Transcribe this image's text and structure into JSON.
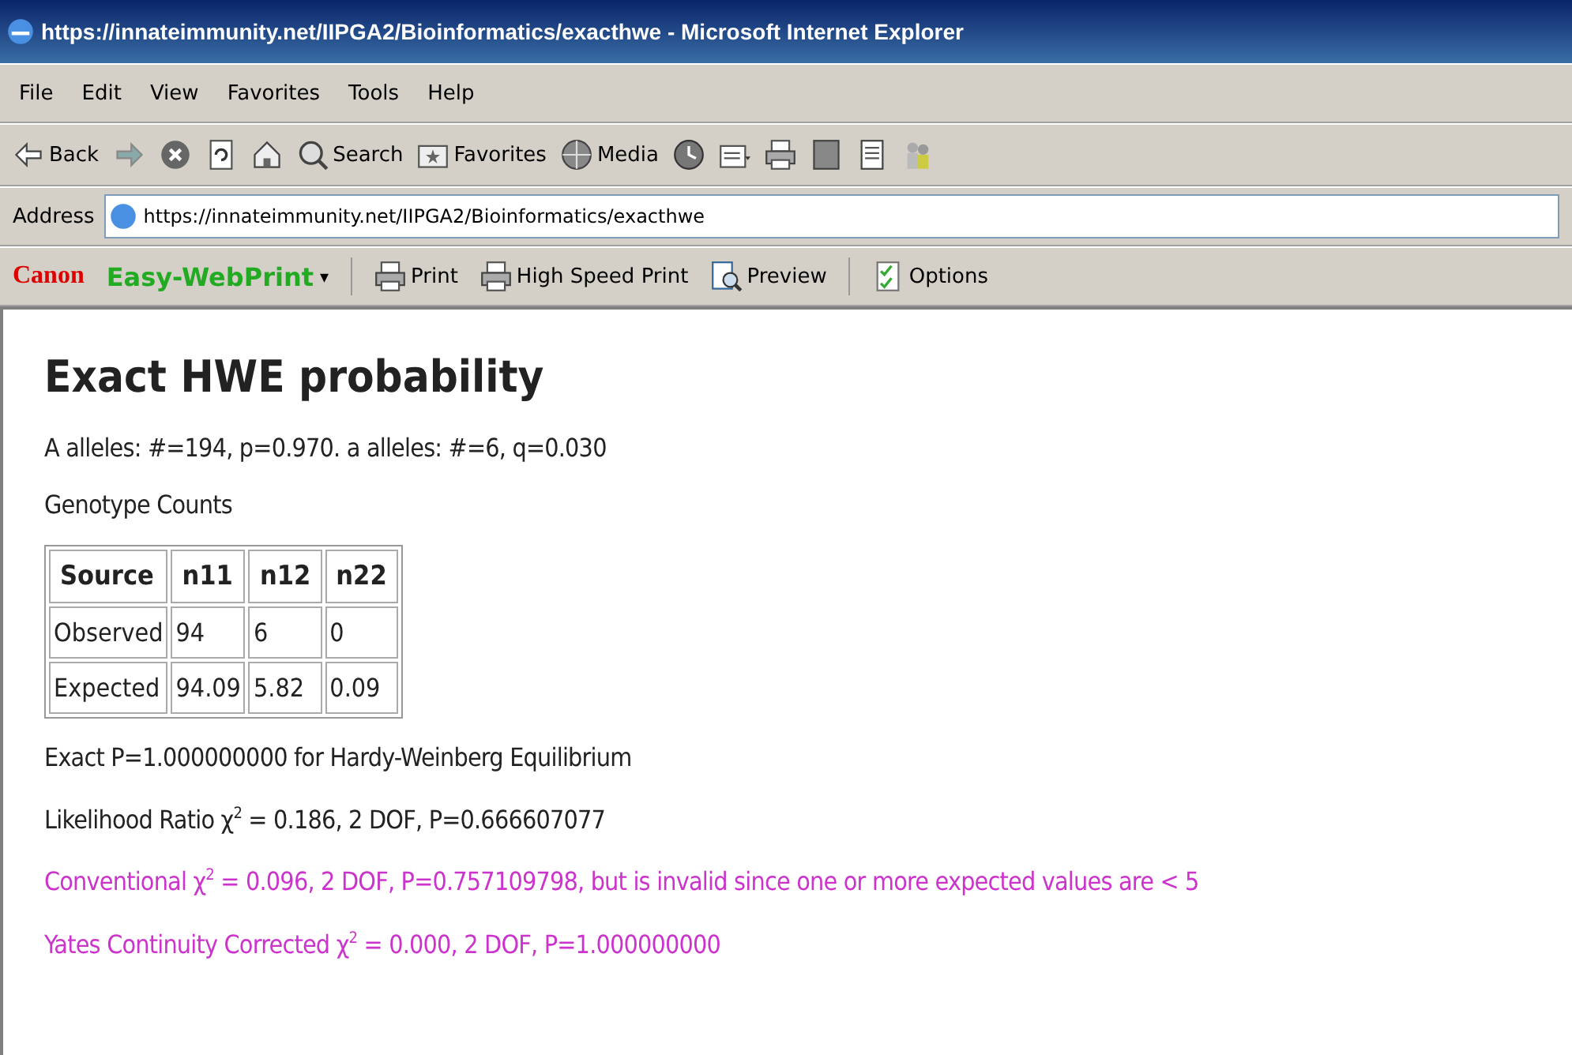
{
  "window": {
    "title": "https://innateimmunity.net/IIPGA2/Bioinformatics/exacthwe - Microsoft Internet Explorer"
  },
  "menu": [
    "File",
    "Edit",
    "View",
    "Favorites",
    "Tools",
    "Help"
  ],
  "toolbar": [
    {
      "kind": "back",
      "label": "Back"
    },
    {
      "kind": "forward"
    },
    {
      "kind": "stop"
    },
    {
      "kind": "refresh"
    },
    {
      "kind": "home"
    },
    {
      "kind": "search",
      "label": "Search"
    },
    {
      "kind": "favorites",
      "label": "Favorites"
    },
    {
      "kind": "media",
      "label": "Media"
    },
    {
      "kind": "history"
    },
    {
      "kind": "mail"
    },
    {
      "kind": "print"
    },
    {
      "kind": "edit"
    },
    {
      "kind": "discuss"
    },
    {
      "kind": "messenger"
    }
  ],
  "address": {
    "label": "Address",
    "value": "https://innateimmunity.net/IIPGA2/Bioinformatics/exacthwe"
  },
  "printbar": {
    "brand": "Canon",
    "product": "Easy-WebPrint",
    "product_caret": "▾",
    "buttons": [
      {
        "kind": "print",
        "label": "Print"
      },
      {
        "kind": "print",
        "label": "High Speed Print"
      },
      {
        "kind": "preview",
        "label": "Preview"
      },
      {
        "kind": "options",
        "label": "Options"
      }
    ]
  },
  "page": {
    "heading": "Exact HWE probability",
    "alleles": "A alleles: #=194, p=0.970. a alleles: #=6, q=0.030",
    "table_caption": "Genotype Counts",
    "table": {
      "columns": [
        "Source",
        "n11",
        "n12",
        "n22"
      ],
      "rows": [
        [
          "Observed",
          "94",
          "6",
          "0"
        ],
        [
          "Expected",
          "94.09",
          "5.82",
          "0.09"
        ]
      ]
    },
    "results": [
      {
        "kind": "normal",
        "text": "Exact P=1.000000000 for Hardy-Weinberg Equilibrium"
      },
      {
        "kind": "normal",
        "text": "Likelihood Ratio χ$^{2}$ = 0.186, 2 DOF, P=0.666607077"
      },
      {
        "kind": "warning",
        "text": "Conventional χ$^{2}$ = 0.096, 2 DOF, P=0.757109798, but is invalid since one or more expected values are < 5"
      },
      {
        "kind": "warning",
        "text": "Yates Continuity Corrected χ$^{2}$ = 0.000, 2 DOF, P=1.000000000"
      }
    ]
  }
}
